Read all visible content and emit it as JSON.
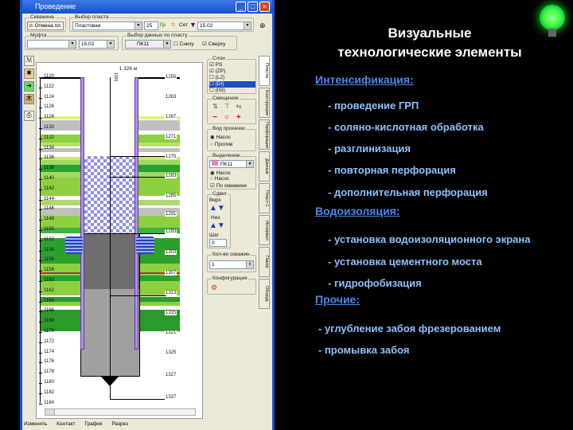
{
  "window": {
    "title": "Проведение",
    "min": "_",
    "max": "□",
    "close": "×"
  },
  "toolbar": {
    "group1_label": "Скважина",
    "cancel_button": "Отмена пл.",
    "group2_label": "Выбор пласта",
    "layer_select": "Пластовая",
    "step_value": "25",
    "graph_button": "Гр",
    "set_label": "Сет",
    "date_select": "15.02",
    "group3_label": "Муфта",
    "muf_select": "",
    "muf_date": "15.02",
    "group4_label": "Выбор данных по пласту",
    "data_select": "ПК11",
    "check_bottom": "Снизу",
    "check_top": "Сверху"
  },
  "log": {
    "header": "1 326 м",
    "depths_left": [
      "1120",
      "1122",
      "1124",
      "1126",
      "1128",
      "1130",
      "1132",
      "1134",
      "1136",
      "1138",
      "1140",
      "1142",
      "1144",
      "1146",
      "1148",
      "1150",
      "1152",
      "1154",
      "1156",
      "1158",
      "1160",
      "1162",
      "1164",
      "1166",
      "1168",
      "1170",
      "1172",
      "1174",
      "1176",
      "1178",
      "1180",
      "1182",
      "1184"
    ],
    "depths_right": [
      "1255",
      "1263",
      "1267",
      "1271",
      "1275",
      "1283",
      "1285",
      "1291",
      "1293",
      "1303",
      "1307",
      "1313",
      "1315",
      "1321",
      "1325",
      "1327",
      "1337"
    ],
    "casing_label": "1326"
  },
  "panel": {
    "layers_label": "Слои",
    "layers": [
      "PS",
      "(ZP)",
      "(L2)",
      "(DI)",
      "(ISI)"
    ],
    "shift_label": "Смещение",
    "pump_label": "Вид прокачки",
    "pump_opts": [
      "Насос",
      "Пролив"
    ],
    "select_label": "Выделение",
    "select_value": "ПК11",
    "sel_opts": [
      "Насос",
      "Насос"
    ],
    "by_well": "По скважине",
    "move_label": "Сдвиг",
    "top_label": "Верх",
    "bottom_label": "Низ",
    "step_label": "Шаг",
    "step_value": "0",
    "count_label": "Кол-во скважин",
    "count_value": "1",
    "config_label": "Конфигурация"
  },
  "vtabs": [
    "Пласты",
    "Конструкция",
    "Перфорация",
    "Данные",
    "Пласт-1",
    "Интервал",
    "Пакер",
    "Оборуд."
  ],
  "bottom_tabs": [
    "Изменить",
    "Контакт",
    "График",
    "Разрез"
  ],
  "slide": {
    "title1": "Визуальные",
    "title2": "технологические элементы",
    "sections": [
      {
        "heading": "Интенсификация:",
        "items": [
          "- проведение ГРП",
          "- соляно-кислотная обработка",
          "- разглинизация",
          "- повторная перфорация",
          "- дополнительная перфорация"
        ]
      },
      {
        "heading": "Водоизоляция:",
        "items": [
          "- установка водоизоляционного экрана",
          "- установка цементного моста",
          "- гидрофобизация"
        ]
      },
      {
        "heading": "Прочие:",
        "items": [
          "- углубление забоя фрезерованием",
          "- промывка забоя"
        ]
      }
    ]
  },
  "colors": {
    "accent": "#4a88ea",
    "bullet": "#8fc0ff",
    "bulb": "#3cff3c"
  }
}
